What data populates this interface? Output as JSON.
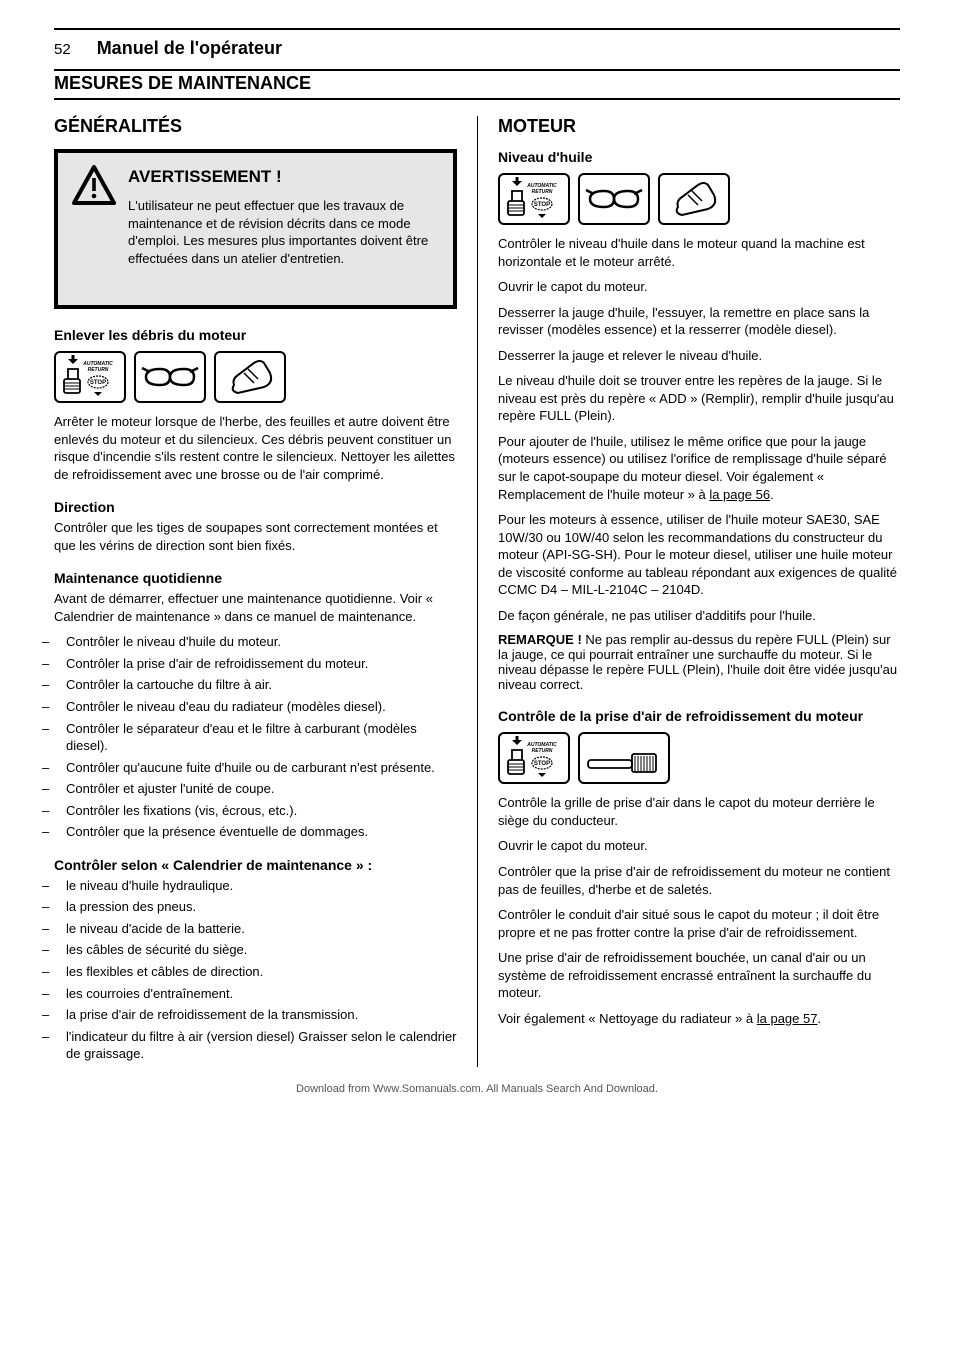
{
  "header": {
    "page_number": "52",
    "title": "Manuel de l'opérateur"
  },
  "section_bar": "MESURES DE MAINTENANCE",
  "left": {
    "h1": "GÉNÉRALITÉS",
    "warning": {
      "title": "AVERTISSEMENT !",
      "text": "L'utilisateur ne peut effectuer que les travaux de maintenance et de révision décrits dans ce mode d'emploi. Les mesures plus importantes doivent être effectuées dans un atelier d'entretien."
    },
    "debris_h": "Enlever les débris du moteur",
    "debris_p1": "Arrêter le moteur lorsque de l'herbe, des feuilles et autre doivent être enlevés du moteur et du silencieux. Ces débris peuvent constituer un risque d'incendie s'ils restent contre le silencieux. Nettoyer les ailettes de refroidissement avec une brosse ou de l'air comprimé.",
    "steering_h": "Direction",
    "steering_p1": "Contrôler que les tiges de soupapes sont correctement montées et que les vérins de direction sont bien fixés.",
    "daily_h": "Maintenance quotidienne",
    "daily_intro": "Avant de démarrer, effectuer une maintenance quotidienne. Voir « Calendrier de maintenance » dans ce manuel de maintenance.",
    "daily_items": [
      "Contrôler le niveau d'huile du moteur.",
      "Contrôler la prise d'air de refroidissement du moteur.",
      "Contrôler la cartouche du filtre à air.",
      "Contrôler le niveau d'eau du radiateur (modèles diesel).",
      "Contrôler le séparateur d'eau et le filtre à carburant (modèles diesel).",
      "Contrôler qu'aucune fuite d'huile ou de carburant n'est présente.",
      "Contrôler et ajuster l'unité de coupe.",
      "Contrôler les fixations (vis, écrous, etc.).",
      "Contrôler que la présence éventuelle de dommages."
    ],
    "sched_h": "Contrôler selon « Calendrier de maintenance » :",
    "sched_items": [
      "le niveau d'huile hydraulique.",
      "la pression des pneus.",
      "le niveau d'acide de la batterie.",
      "les câbles de sécurité du siège.",
      "les flexibles et câbles de direction.",
      "les courroies d'entraînement.",
      "la prise d'air de refroidissement de la transmission.",
      "l'indicateur du filtre à air (version diesel) Graisser selon le calendrier de graissage."
    ]
  },
  "right": {
    "h1": "MOTEUR",
    "oil_h": "Niveau d'huile",
    "oil_p1": "Contrôler le niveau d'huile dans le moteur quand la machine est horizontale et le moteur arrêté.",
    "oil_p2": "Ouvrir le capot du moteur.",
    "oil_p3": "Desserrer la jauge d'huile, l'essuyer, la remettre en place sans la revisser (modèles essence) et la resserrer (modèle diesel).",
    "oil_p4": "Desserrer la jauge et relever le niveau d'huile.",
    "oil_p5": "Le niveau d'huile doit se trouver entre les repères de la jauge. Si le niveau est près du repère « ADD » (Remplir), remplir d'huile jusqu'au repère FULL (Plein).",
    "oil_p6_a": "Pour ajouter de l'huile, utilisez le même orifice que pour la jauge (moteurs essence) ou utilisez l'orifice de remplissage d'huile séparé sur le capot-soupape du moteur diesel. Voir également « Remplacement de l'huile moteur » à ",
    "oil_p6_link": "la page 56",
    "oil_p6_b": ".",
    "oil_p7": "Pour les moteurs à essence, utiliser de l'huile moteur SAE30, SAE 10W/30 ou 10W/40 selon les recommandations du constructeur du moteur (API-SG-SH). Pour le moteur diesel, utiliser une huile moteur de viscosité conforme au tableau répondant aux exigences de qualité CCMC D4 – MIL-L-2104C – 2104D.",
    "oil_p8": "De façon générale, ne pas utiliser d'additifs pour l'huile.",
    "note_label": "REMARQUE !",
    "note_text": "Ne pas remplir au-dessus du repère FULL (Plein) sur la jauge, ce qui pourrait entraîner une surchauffe du moteur. Si le niveau dépasse le repère FULL (Plein), l'huile doit être vidée jusqu'au niveau correct.",
    "intake_h": "Contrôle de la prise d'air de refroidissement du moteur",
    "intake_p1": "Contrôle la grille de prise d'air dans le capot du moteur derrière le siège du conducteur.",
    "intake_p2": "Ouvrir le capot du moteur.",
    "intake_p3": "Contrôler que la prise d'air de refroidissement du moteur ne contient pas de feuilles, d'herbe et de saletés.",
    "intake_p4": "Contrôler le conduit d'air situé sous le capot du moteur ; il doit être propre et ne pas frotter contre la prise d'air de refroidissement.",
    "intake_p5": "Une prise d'air de refroidissement bouchée, un canal d'air ou un système de refroidissement encrassé entraînent la surchauffe du moteur.",
    "intake_p6_a": "Voir également « Nettoyage du radiateur » à ",
    "intake_p6_link": "la page 57",
    "intake_p6_b": "."
  },
  "footer": "Download from Www.Somanuals.com. All Manuals Search And Download."
}
